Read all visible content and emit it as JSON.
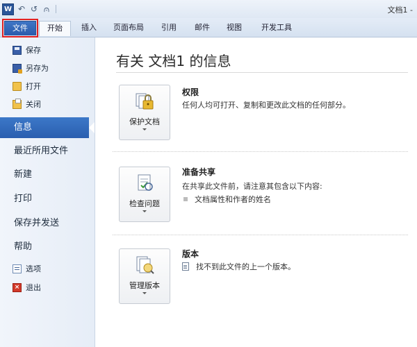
{
  "titlebar": {
    "app_icon": "W",
    "undo_glyph": "↶",
    "redo_glyph": "↺",
    "qat_extra_glyph": "⩀",
    "doc_title": "文档1 -"
  },
  "tabs": [
    {
      "label": "文件"
    },
    {
      "label": "开始"
    },
    {
      "label": "插入"
    },
    {
      "label": "页面布局"
    },
    {
      "label": "引用"
    },
    {
      "label": "邮件"
    },
    {
      "label": "视图"
    },
    {
      "label": "开发工具"
    }
  ],
  "backstage": {
    "commands_top": [
      {
        "label": "保存",
        "icon": "save-icon"
      },
      {
        "label": "另存为",
        "icon": "save-as-icon"
      },
      {
        "label": "打开",
        "icon": "open-folder-icon"
      },
      {
        "label": "关闭",
        "icon": "close-doc-icon"
      }
    ],
    "nav": [
      {
        "label": "信息",
        "active": true
      },
      {
        "label": "最近所用文件"
      },
      {
        "label": "新建"
      },
      {
        "label": "打印"
      },
      {
        "label": "保存并发送"
      },
      {
        "label": "帮助"
      }
    ],
    "commands_bottom": [
      {
        "label": "选项",
        "icon": "options-icon"
      },
      {
        "label": "退出",
        "icon": "exit-icon"
      }
    ]
  },
  "info": {
    "title": "有关 文档1 的信息",
    "sections": [
      {
        "button_label": "保护文档",
        "heading": "权限",
        "description": "任何人均可打开、复制和更改此文档的任何部分。"
      },
      {
        "button_label": "检查问题",
        "heading": "准备共享",
        "description": "在共享此文件前，请注意其包含以下内容:",
        "bullet": "文档属性和作者的姓名"
      },
      {
        "button_label": "管理版本",
        "heading": "版本",
        "description": "找不到此文件的上一个版本。"
      }
    ]
  },
  "colors": {
    "file_tab": "#2a5bab",
    "active_nav": "#2a5eaf",
    "highlight_box": "#e02020"
  }
}
